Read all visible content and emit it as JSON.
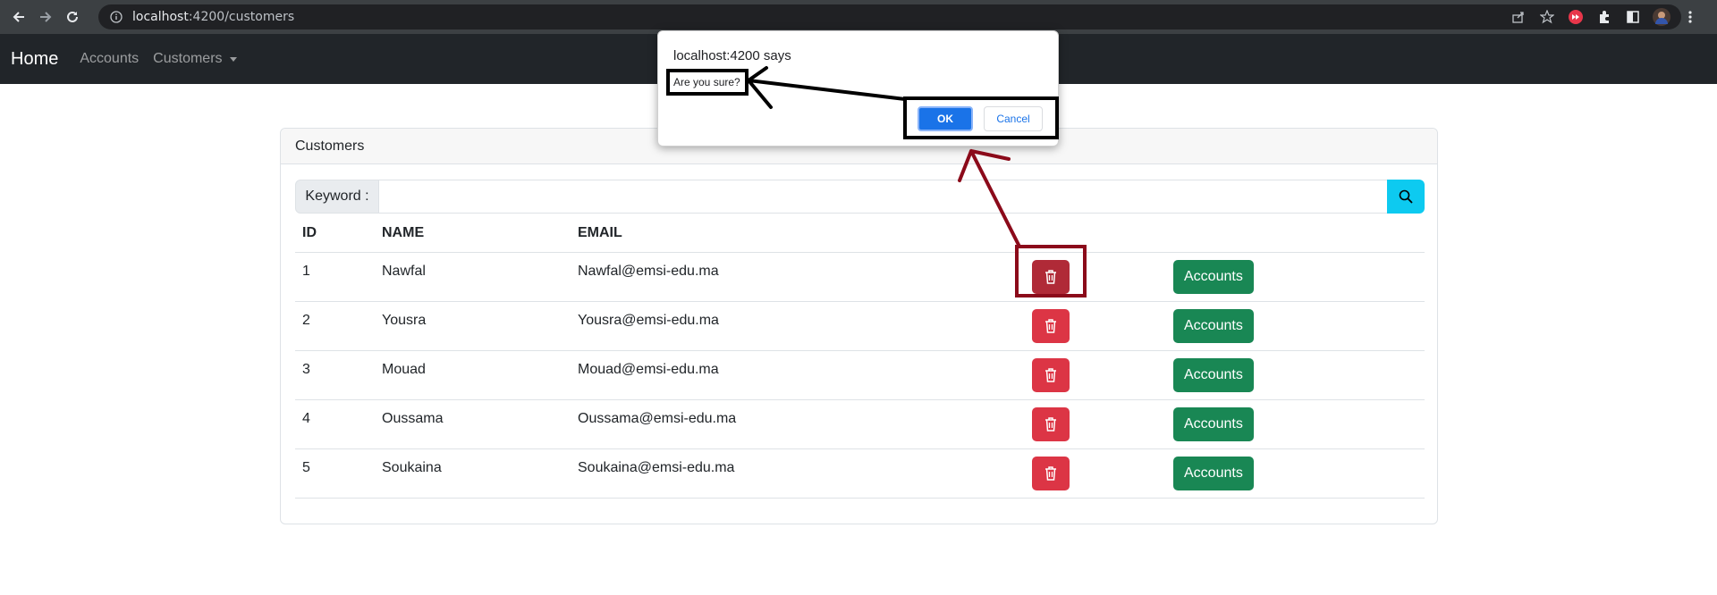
{
  "browser": {
    "url_host": "localhost",
    "url_rest": ":4200/customers"
  },
  "navbar": {
    "brand": "Home",
    "links": [
      "Accounts",
      "Customers"
    ]
  },
  "card": {
    "header": "Customers",
    "search": {
      "label": "Keyword :",
      "value": "",
      "placeholder": ""
    },
    "columns": [
      "ID",
      "NAME",
      "EMAIL"
    ],
    "rows": [
      {
        "id": "1",
        "name": "Nawfal",
        "email": "Nawfal@emsi-edu.ma",
        "action": "Accounts"
      },
      {
        "id": "2",
        "name": "Yousra",
        "email": "Yousra@emsi-edu.ma",
        "action": "Accounts"
      },
      {
        "id": "3",
        "name": "Mouad",
        "email": "Mouad@emsi-edu.ma",
        "action": "Accounts"
      },
      {
        "id": "4",
        "name": "Oussama",
        "email": "Oussama@emsi-edu.ma",
        "action": "Accounts"
      },
      {
        "id": "5",
        "name": "Soukaina",
        "email": "Soukaina@emsi-edu.ma",
        "action": "Accounts"
      }
    ]
  },
  "dialog": {
    "title": "localhost:4200 says",
    "message": "Are you sure?",
    "ok_label": "OK",
    "cancel_label": "Cancel"
  },
  "colors": {
    "navbar_bg": "#212529",
    "delete": "#dc3545",
    "accounts": "#198754",
    "search": "#0dcaf0",
    "annotation_black": "#000000",
    "annotation_red": "#8b0a1a"
  }
}
